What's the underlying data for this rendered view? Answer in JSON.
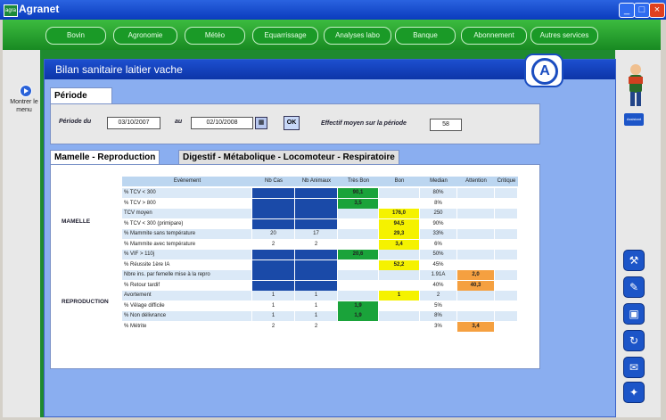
{
  "window": {
    "title": "Agranet",
    "logo_text": "agra"
  },
  "menu": [
    "Bovin",
    "Agronomie",
    "Météo",
    "Equarrissage",
    "Analyses labo",
    "Banque",
    "Abonnement",
    "Autres services"
  ],
  "nav": {
    "label": "Montrer le menu"
  },
  "panel": {
    "title": "Bilan sanitaire laitier vache"
  },
  "logo": {
    "letter": "A"
  },
  "period": {
    "tab": "Période",
    "from_label": "Période du",
    "from_value": "03/10/2007",
    "to_label": "au",
    "to_value": "02/10/2008",
    "ok_label": "OK",
    "effectif_label": "Effectif moyen sur la période",
    "effectif_value": "58"
  },
  "tabs": [
    "Mamelle - Reproduction",
    "Digestif - Métabolique - Locomoteur - Respiratoire"
  ],
  "table": {
    "headers": [
      "Evènement",
      "Nb Cas",
      "Nb Animaux",
      "Très Bon",
      "Bon",
      "Median",
      "Attention",
      "Critique"
    ],
    "groups": [
      {
        "label": "MAMELLE"
      },
      {
        "label": "REPRODUCTION"
      }
    ],
    "rows": [
      {
        "event": "% TCV < 300",
        "nbcas": "",
        "nbanim": "",
        "tresbon": "90,1",
        "bon": "",
        "median": "80%",
        "attention": "",
        "critique": ""
      },
      {
        "event": "% TCV > 800",
        "nbcas": "",
        "nbanim": "",
        "tresbon": "3,5",
        "bon": "",
        "median": "8%",
        "attention": "",
        "critique": ""
      },
      {
        "event": "TCV moyen",
        "nbcas": "",
        "nbanim": "",
        "tresbon": "",
        "bon": "176,0",
        "median": "250",
        "attention": "",
        "critique": ""
      },
      {
        "event": "% TCV < 300 (primipare)",
        "nbcas": "",
        "nbanim": "",
        "tresbon": "",
        "bon": "94,5",
        "median": "90%",
        "attention": "",
        "critique": ""
      },
      {
        "event": "% Mammite sans température",
        "nbcas": "20",
        "nbanim": "17",
        "tresbon": "",
        "bon": "29,3",
        "median": "33%",
        "attention": "",
        "critique": ""
      },
      {
        "event": "% Mammite avec température",
        "nbcas": "2",
        "nbanim": "2",
        "tresbon": "",
        "bon": "3,4",
        "median": "6%",
        "attention": "",
        "critique": ""
      },
      {
        "event": "% VIF > 110j",
        "nbcas": "",
        "nbanim": "",
        "tresbon": "20,6",
        "bon": "",
        "median": "50%",
        "attention": "",
        "critique": ""
      },
      {
        "event": "% Réussite 1ère IA",
        "nbcas": "",
        "nbanim": "",
        "tresbon": "",
        "bon": "52,2",
        "median": "45%",
        "attention": "",
        "critique": ""
      },
      {
        "event": "Nbre ins. par femelle mise à la repro",
        "nbcas": "",
        "nbanim": "",
        "tresbon": "",
        "bon": "",
        "median": "1.91A",
        "attention": "2,0",
        "critique": ""
      },
      {
        "event": "% Retour tardif",
        "nbcas": "",
        "nbanim": "",
        "tresbon": "",
        "bon": "",
        "median": "40%",
        "attention": "40,3",
        "critique": ""
      },
      {
        "event": "Avortement",
        "nbcas": "1",
        "nbanim": "1",
        "tresbon": "",
        "bon": "1",
        "median": "2",
        "attention": "",
        "critique": ""
      },
      {
        "event": "% Vêlage difficile",
        "nbcas": "1",
        "nbanim": "1",
        "tresbon": "1,9",
        "bon": "",
        "median": "5%",
        "attention": "",
        "critique": ""
      },
      {
        "event": "% Non délivrance",
        "nbcas": "1",
        "nbanim": "1",
        "tresbon": "1,9",
        "bon": "",
        "median": "8%",
        "attention": "",
        "critique": ""
      },
      {
        "event": "% Métrite",
        "nbcas": "2",
        "nbanim": "2",
        "tresbon": "",
        "bon": "",
        "median": "3%",
        "attention": "3,4",
        "critique": ""
      }
    ]
  },
  "right_panel": {
    "assistant_label": "Assistant",
    "tools": [
      "tools-icon",
      "pencil-icon",
      "lock-icon",
      "refresh-icon",
      "mail-icon",
      "notebook-icon"
    ]
  },
  "colors": {
    "green": "#1aa33a",
    "yellow": "#f5f200",
    "orange": "#f5a040",
    "navy": "#1a4aa8",
    "row_a": "#dbe9f7",
    "row_b": "#ffffff"
  }
}
